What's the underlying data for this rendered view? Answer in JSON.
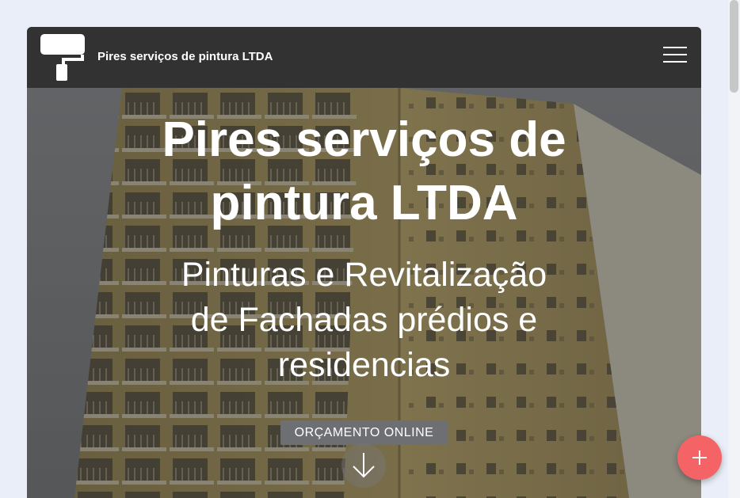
{
  "header": {
    "brand": "Pires serviços de pintura LTDA",
    "logo_icon": "paint-roller-icon",
    "menu_icon": "hamburger-menu-icon"
  },
  "hero": {
    "title_line1": "Pires serviços de",
    "title_line2": "pintura LTDA",
    "subtitle_line1": "Pinturas e Revitalização",
    "subtitle_line2": "de Fachadas prédios e",
    "subtitle_line3": "residencias",
    "cta_label": "ORÇAMENTO ONLINE",
    "scroll_icon": "arrow-down-icon",
    "background_image": "apartment building facade"
  },
  "fab": {
    "icon": "plus-icon",
    "color": "#f46467"
  },
  "colors": {
    "header_bg": "#333232",
    "page_bg": "#e9eef8",
    "cta_bg": "#6d6f72"
  }
}
